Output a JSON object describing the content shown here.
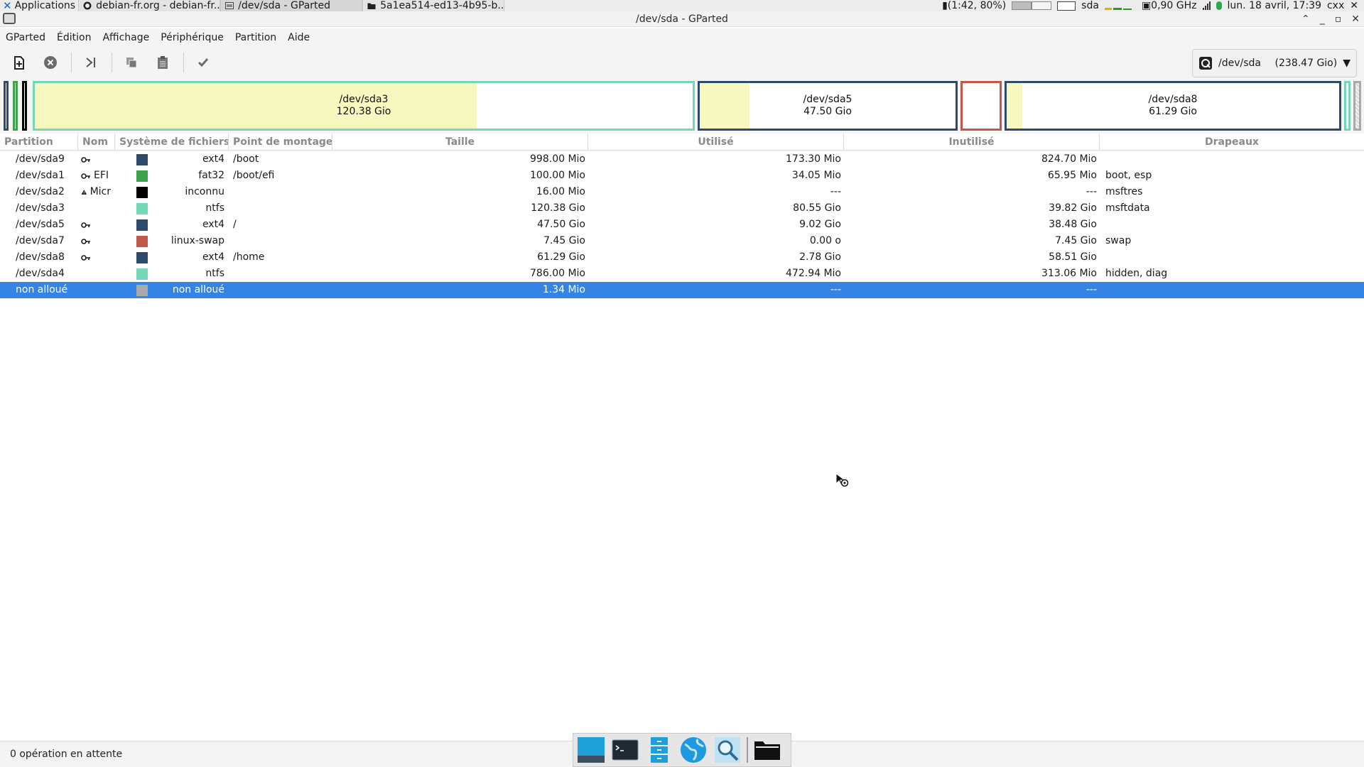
{
  "panel": {
    "apps_label": "Applications",
    "tasks": [
      {
        "label": "debian-fr.org - debian-fr..."
      },
      {
        "label": "/dev/sda - GParted"
      },
      {
        "label": "5a1ea514-ed13-4b95-b..."
      }
    ],
    "battery": "(1:42, 80%)",
    "disk_label": "sda",
    "cpu_freq": "0,90 GHz",
    "clock": "lun. 18 avril, 17:39",
    "user": "cxx"
  },
  "window": {
    "title": "/dev/sda - GParted"
  },
  "menu": [
    "GParted",
    "Édition",
    "Affichage",
    "Périphérique",
    "Partition",
    "Aide"
  ],
  "device": {
    "name": "/dev/sda",
    "size": "(238.47 Gio)"
  },
  "diskmap": [
    {
      "name": "/dev/sda3",
      "size": "120.38 Gio"
    },
    {
      "name": "/dev/sda5",
      "size": "47.50 Gio"
    },
    {
      "name": "/dev/sda8",
      "size": "61.29 Gio"
    }
  ],
  "columns": [
    "Partition",
    "Nom",
    "Système de fichiers",
    "Point de montage",
    "Taille",
    "Utilisé",
    "Inutilisé",
    "Drapeaux"
  ],
  "rows": [
    {
      "partition": "/dev/sda9",
      "name": "",
      "key": true,
      "warn": false,
      "fs": "ext4",
      "color": "#2d4a6b",
      "mount": "/boot",
      "size": "998.00 Mio",
      "used": "173.30 Mio",
      "unused": "824.70 Mio",
      "flags": ""
    },
    {
      "partition": "/dev/sda1",
      "name": "EFI",
      "key": true,
      "warn": false,
      "fs": "fat32",
      "color": "#3ea34c",
      "mount": "/boot/efi",
      "size": "100.00 Mio",
      "used": "34.05 Mio",
      "unused": "65.95 Mio",
      "flags": "boot, esp"
    },
    {
      "partition": "/dev/sda2",
      "name": "Micr",
      "key": false,
      "warn": true,
      "fs": "inconnu",
      "color": "#000000",
      "mount": "",
      "size": "16.00 Mio",
      "used": "---",
      "unused": "---",
      "flags": "msftres"
    },
    {
      "partition": "/dev/sda3",
      "name": "",
      "key": false,
      "warn": false,
      "fs": "ntfs",
      "color": "#74d7b8",
      "mount": "",
      "size": "120.38 Gio",
      "used": "80.55 Gio",
      "unused": "39.82 Gio",
      "flags": "msftdata"
    },
    {
      "partition": "/dev/sda5",
      "name": "",
      "key": true,
      "warn": false,
      "fs": "ext4",
      "color": "#2d4a6b",
      "mount": "/",
      "size": "47.50 Gio",
      "used": "9.02 Gio",
      "unused": "38.48 Gio",
      "flags": ""
    },
    {
      "partition": "/dev/sda7",
      "name": "",
      "key": true,
      "warn": false,
      "fs": "linux-swap",
      "color": "#c2574b",
      "mount": "",
      "size": "7.45 Gio",
      "used": "0.00 o",
      "unused": "7.45 Gio",
      "flags": "swap"
    },
    {
      "partition": "/dev/sda8",
      "name": "",
      "key": true,
      "warn": false,
      "fs": "ext4",
      "color": "#2d4a6b",
      "mount": "/home",
      "size": "61.29 Gio",
      "used": "2.78 Gio",
      "unused": "58.51 Gio",
      "flags": ""
    },
    {
      "partition": "/dev/sda4",
      "name": "",
      "key": false,
      "warn": false,
      "fs": "ntfs",
      "color": "#74d7b8",
      "mount": "",
      "size": "786.00 Mio",
      "used": "472.94 Mio",
      "unused": "313.06 Mio",
      "flags": "hidden, diag"
    },
    {
      "partition": "non alloué",
      "name": "",
      "key": false,
      "warn": false,
      "fs": "non alloué",
      "color": "#a9a9a9",
      "mount": "",
      "size": "1.34 Mio",
      "used": "---",
      "unused": "---",
      "flags": "",
      "selected": true
    }
  ],
  "status": "0 opération en attente"
}
